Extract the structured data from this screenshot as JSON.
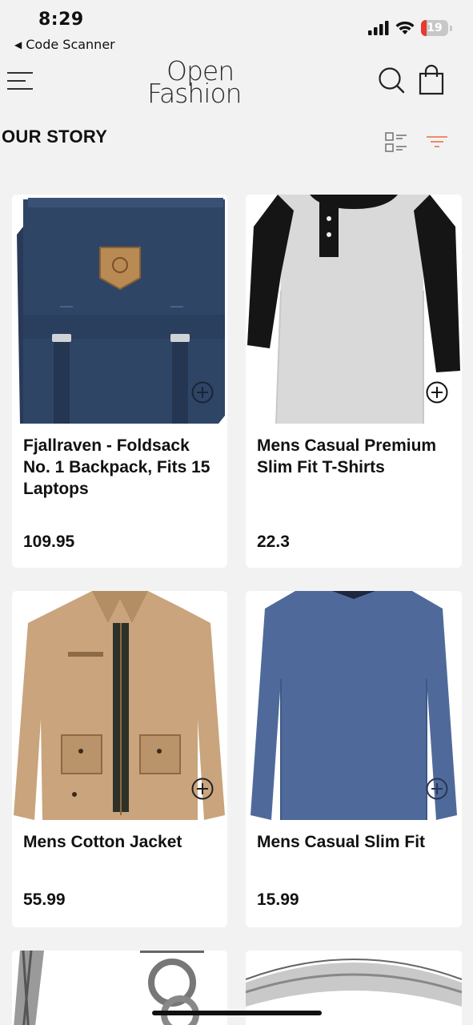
{
  "status": {
    "time": "8:29",
    "back_app": "Code Scanner",
    "battery": "19",
    "icons": [
      "signal-icon",
      "wifi-icon",
      "battery-icon"
    ]
  },
  "header": {
    "brand_line1": "Open",
    "brand_line2": "Fashion",
    "icons": [
      "menu-icon",
      "search-icon",
      "shopping-bag-icon"
    ]
  },
  "section": {
    "title": "OUR STORY",
    "icons": [
      "list-view-icon",
      "filter-icon"
    ],
    "filter_color": "#e8805c"
  },
  "products": [
    {
      "name": "Fjallraven - Foldsack No. 1 Backpack, Fits 15 Laptops",
      "price": "109.95",
      "image": "navy backpack"
    },
    {
      "name": "Mens Casual Premium Slim Fit T-Shirts",
      "price": "22.3",
      "image": "grey raglan henley shirt"
    },
    {
      "name": "Mens Cotton Jacket",
      "price": "55.99",
      "image": "khaki cotton jacket"
    },
    {
      "name": "Mens Casual Slim Fit",
      "price": "15.99",
      "image": "blue long sleeve t-shirt"
    },
    {
      "name": "",
      "price": "",
      "image": "silver chain bracelet"
    },
    {
      "name": "",
      "price": "",
      "image": "silver ring"
    }
  ]
}
